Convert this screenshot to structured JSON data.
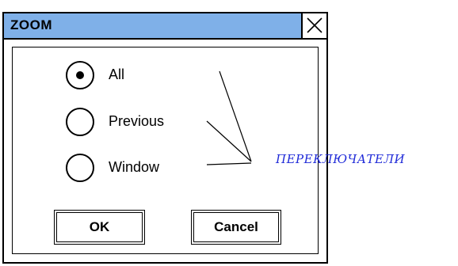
{
  "window": {
    "title": "ZOOM",
    "close_icon": "close-icon"
  },
  "radio_group": {
    "options": [
      {
        "label": "All",
        "selected": true
      },
      {
        "label": "Previous",
        "selected": false
      },
      {
        "label": "Window",
        "selected": false
      }
    ]
  },
  "buttons": {
    "ok_label": "OK",
    "cancel_label": "Cancel"
  },
  "annotation": {
    "text": "ПЕРЕКЛЮЧАТЕЛИ",
    "color": "#1f2ad8"
  },
  "colors": {
    "titlebar": "#7fb0e8"
  }
}
